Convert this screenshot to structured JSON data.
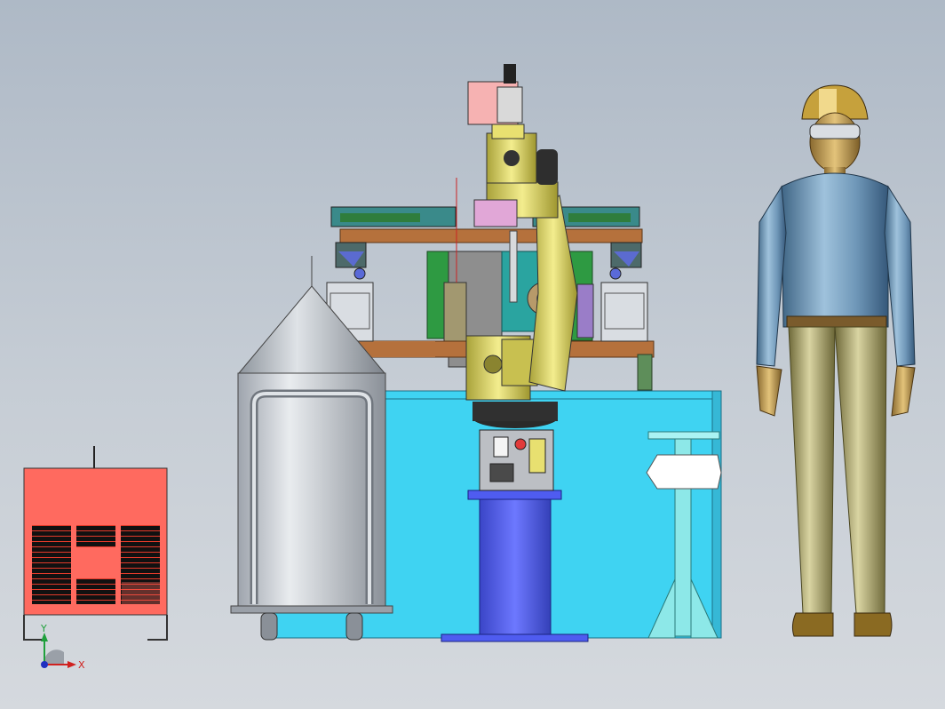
{
  "triad": {
    "x_label": "X",
    "y_label": "Y"
  },
  "colors": {
    "background_top": "#aeb9c6",
    "water_tank": "#3fd3f2",
    "robot_yellow": "#e8e070",
    "pedestal_blue": "#4f5cf0",
    "welder_red": "#ff6a5f",
    "barrel_silver": "#c5c9cf"
  }
}
